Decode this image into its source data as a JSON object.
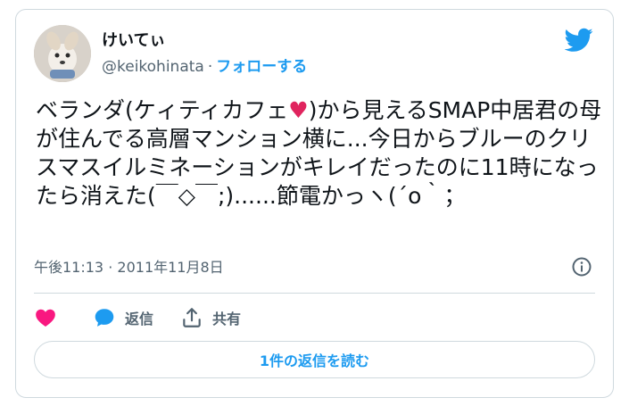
{
  "user": {
    "display_name": "けいてぃ",
    "handle": "@keikohinata",
    "separator": "·",
    "follow_label": "フォローする"
  },
  "tweet": {
    "text_before_heart": "ベランダ(ケィティカフェ",
    "heart": "♥",
    "text_after_heart": ")から見えるSMAP中居君の母が住んでる高層マンション横に...今日からブルーのクリスマスイルミネーションがキレイだったのに11時になったら消えた(￣◇￣;)......節電かっヽ(´o｀；"
  },
  "meta": {
    "time": "午後11:13",
    "separator": "·",
    "date": "2011年11月8日"
  },
  "actions": {
    "like_icon": "heart-icon",
    "reply_label": "返信",
    "share_label": "共有"
  },
  "read_replies_label": "1件の返信を読む",
  "colors": {
    "accent": "#1d9bf0",
    "like": "#f91880",
    "text": "#0f1419",
    "muted": "#536471",
    "border": "#cfd9de"
  }
}
